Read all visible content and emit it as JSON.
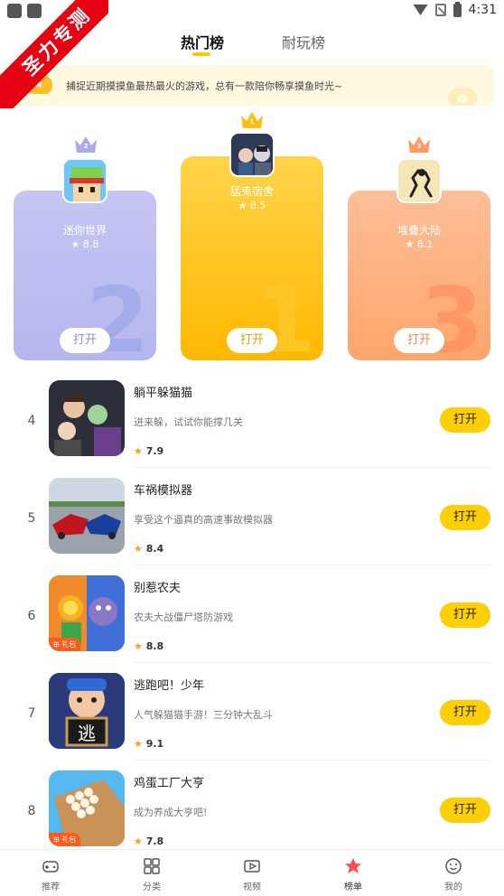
{
  "status_bar": {
    "time": "4:31"
  },
  "ribbon": {
    "text": "圣力专测"
  },
  "tabs": [
    {
      "label": "热门榜",
      "active": true
    },
    {
      "label": "耐玩榜",
      "active": false
    }
  ],
  "banner": {
    "text": "捕捉近期摸摸鱼最热最火的游戏，总有一款陪你畅享摸鱼时光~"
  },
  "podium": [
    {
      "rank": "2",
      "name": "迷你世界",
      "score": "8.8",
      "button": "打开"
    },
    {
      "rank": "1",
      "name": "猛鬼宿舍",
      "score": "8.5",
      "button": "打开"
    },
    {
      "rank": "3",
      "name": "堆叠大陆",
      "score": "8.1",
      "button": "打开"
    }
  ],
  "games": [
    {
      "rank": "4",
      "name": "躺平躲猫猫",
      "desc": "进来躲，试试你能撑几关",
      "score": "7.9",
      "button": "打开",
      "gift": ""
    },
    {
      "rank": "5",
      "name": "车祸模拟器",
      "desc": "享受这个逼真的高速事故模拟器",
      "score": "8.4",
      "button": "打开",
      "gift": ""
    },
    {
      "rank": "6",
      "name": "别惹农夫",
      "desc": "农夫大战僵尸塔防游戏",
      "score": "8.8",
      "button": "打开",
      "gift": "礼包"
    },
    {
      "rank": "7",
      "name": "逃跑吧！少年",
      "desc": "人气躲猫猫手游！三分钟大乱斗",
      "score": "9.1",
      "button": "打开",
      "gift": ""
    },
    {
      "rank": "8",
      "name": "鸡蛋工厂大亨",
      "desc": "成为养成大亨吧!",
      "score": "7.8",
      "button": "打开",
      "gift": "礼包"
    }
  ],
  "thumb_text": {
    "escape": "逃"
  },
  "bottom_nav": [
    {
      "label": "推荐"
    },
    {
      "label": "分类"
    },
    {
      "label": "视频"
    },
    {
      "label": "榜单"
    },
    {
      "label": "我的"
    }
  ],
  "colors": {
    "accent": "#ffcf00",
    "ribbon": "#e60012",
    "silver": "#b4b6ee",
    "gold": "#ffb800",
    "bronze": "#ffa56a"
  }
}
